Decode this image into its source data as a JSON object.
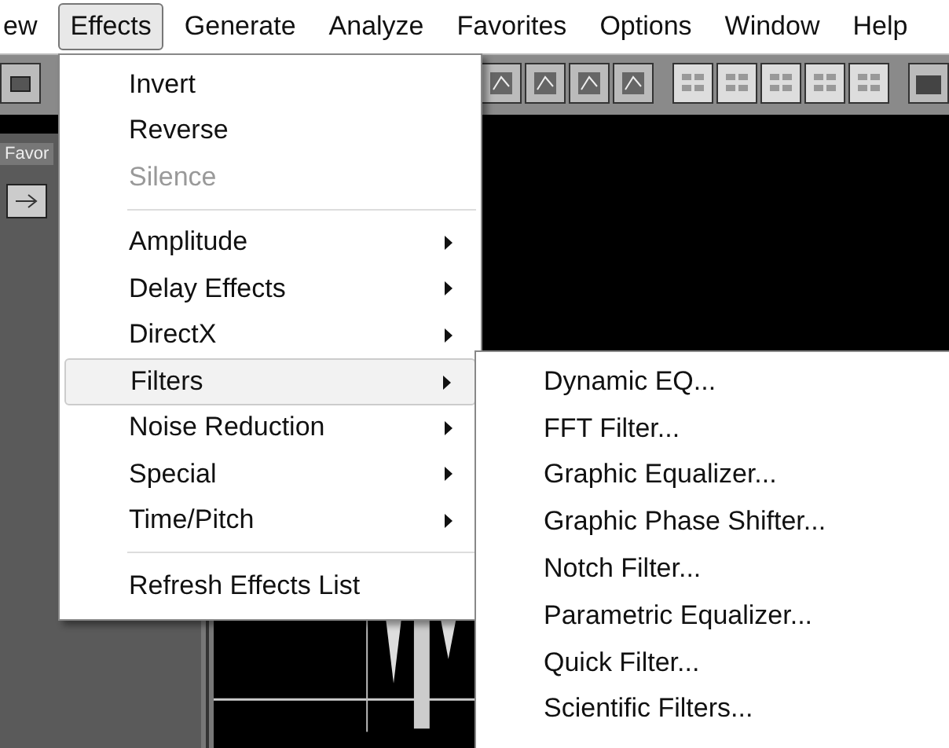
{
  "menubar": [
    {
      "label": "ew",
      "selected": false
    },
    {
      "label": "Effects",
      "selected": true
    },
    {
      "label": "Generate",
      "selected": false
    },
    {
      "label": "Analyze",
      "selected": false
    },
    {
      "label": "Favorites",
      "selected": false
    },
    {
      "label": "Options",
      "selected": false
    },
    {
      "label": "Window",
      "selected": false
    },
    {
      "label": "Help",
      "selected": false
    }
  ],
  "panel_tab": "Favor",
  "effects_menu": [
    {
      "kind": "item",
      "label": "Invert",
      "disabled": false,
      "has_submenu": false,
      "selected": false
    },
    {
      "kind": "item",
      "label": "Reverse",
      "disabled": false,
      "has_submenu": false,
      "selected": false
    },
    {
      "kind": "item",
      "label": "Silence",
      "disabled": true,
      "has_submenu": false,
      "selected": false
    },
    {
      "kind": "separator"
    },
    {
      "kind": "item",
      "label": "Amplitude",
      "disabled": false,
      "has_submenu": true,
      "selected": false
    },
    {
      "kind": "item",
      "label": "Delay Effects",
      "disabled": false,
      "has_submenu": true,
      "selected": false
    },
    {
      "kind": "item",
      "label": "DirectX",
      "disabled": false,
      "has_submenu": true,
      "selected": false
    },
    {
      "kind": "item",
      "label": "Filters",
      "disabled": false,
      "has_submenu": true,
      "selected": true
    },
    {
      "kind": "item",
      "label": "Noise Reduction",
      "disabled": false,
      "has_submenu": true,
      "selected": false
    },
    {
      "kind": "item",
      "label": "Special",
      "disabled": false,
      "has_submenu": true,
      "selected": false
    },
    {
      "kind": "item",
      "label": "Time/Pitch",
      "disabled": false,
      "has_submenu": true,
      "selected": false
    },
    {
      "kind": "separator"
    },
    {
      "kind": "item",
      "label": "Refresh Effects List",
      "disabled": false,
      "has_submenu": false,
      "selected": false
    }
  ],
  "filters_submenu": [
    "Dynamic EQ...",
    "FFT Filter...",
    "Graphic Equalizer...",
    "Graphic Phase Shifter...",
    "Notch Filter...",
    "Parametric Equalizer...",
    "Quick Filter...",
    "Scientific Filters..."
  ]
}
